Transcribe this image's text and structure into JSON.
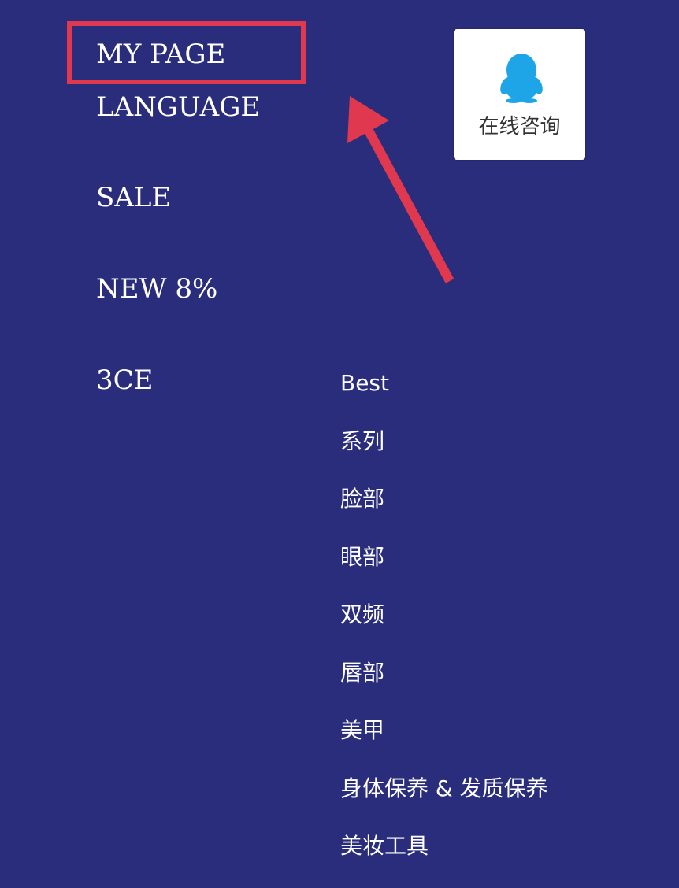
{
  "main_menu": {
    "items": [
      {
        "id": "my-page",
        "label": "MY PAGE"
      },
      {
        "id": "language",
        "label": "LANGUAGE"
      },
      {
        "id": "sale",
        "label": "SALE"
      },
      {
        "id": "new",
        "label": "NEW 8%"
      },
      {
        "id": "3ce",
        "label": "3CE"
      }
    ],
    "highlighted_item": "MY PAGE"
  },
  "consult_widget": {
    "icon": "qq-penguin-icon",
    "label": "在线咨询"
  },
  "sub_menu": {
    "items": [
      "Best",
      "系列",
      "脸部",
      "眼部",
      "双频",
      "唇部",
      "美甲",
      "身体保养 & 发质保养",
      "美妆工具"
    ]
  },
  "colors": {
    "background": "#2a2d7b",
    "highlight": "#e0384f",
    "text": "#ffffff",
    "qq_blue": "#1ea5e8"
  }
}
